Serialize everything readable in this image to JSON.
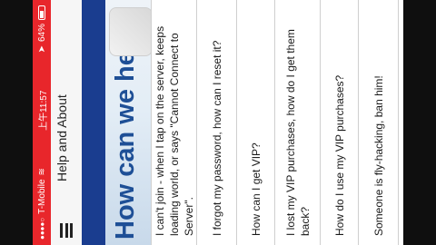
{
  "status_bar": {
    "carrier": "T-Mobile",
    "time": "上午11:57",
    "battery": "64%"
  },
  "header": {
    "title": "Help and About",
    "menu_icon": "hamburger-menu-icon"
  },
  "hero": {
    "title": "How can we help?"
  },
  "faq": {
    "items": [
      {
        "label": "I can't join - when I tap on the server, keeps loading world, or says \"Cannot Connect to Server\"."
      },
      {
        "label": "I forgot my password, how can I reset it?"
      },
      {
        "label": "How can I get VIP?"
      },
      {
        "label": "I lost my VIP purchases, how do I get them back?"
      },
      {
        "label": "How do I use my VIP purchases?"
      },
      {
        "label": "Someone is fly-hacking, ban him!"
      }
    ]
  },
  "colors": {
    "status_bar": "#e8262b",
    "nav_strip": "#1a3d8f",
    "hero_text": "#1e4f96"
  }
}
